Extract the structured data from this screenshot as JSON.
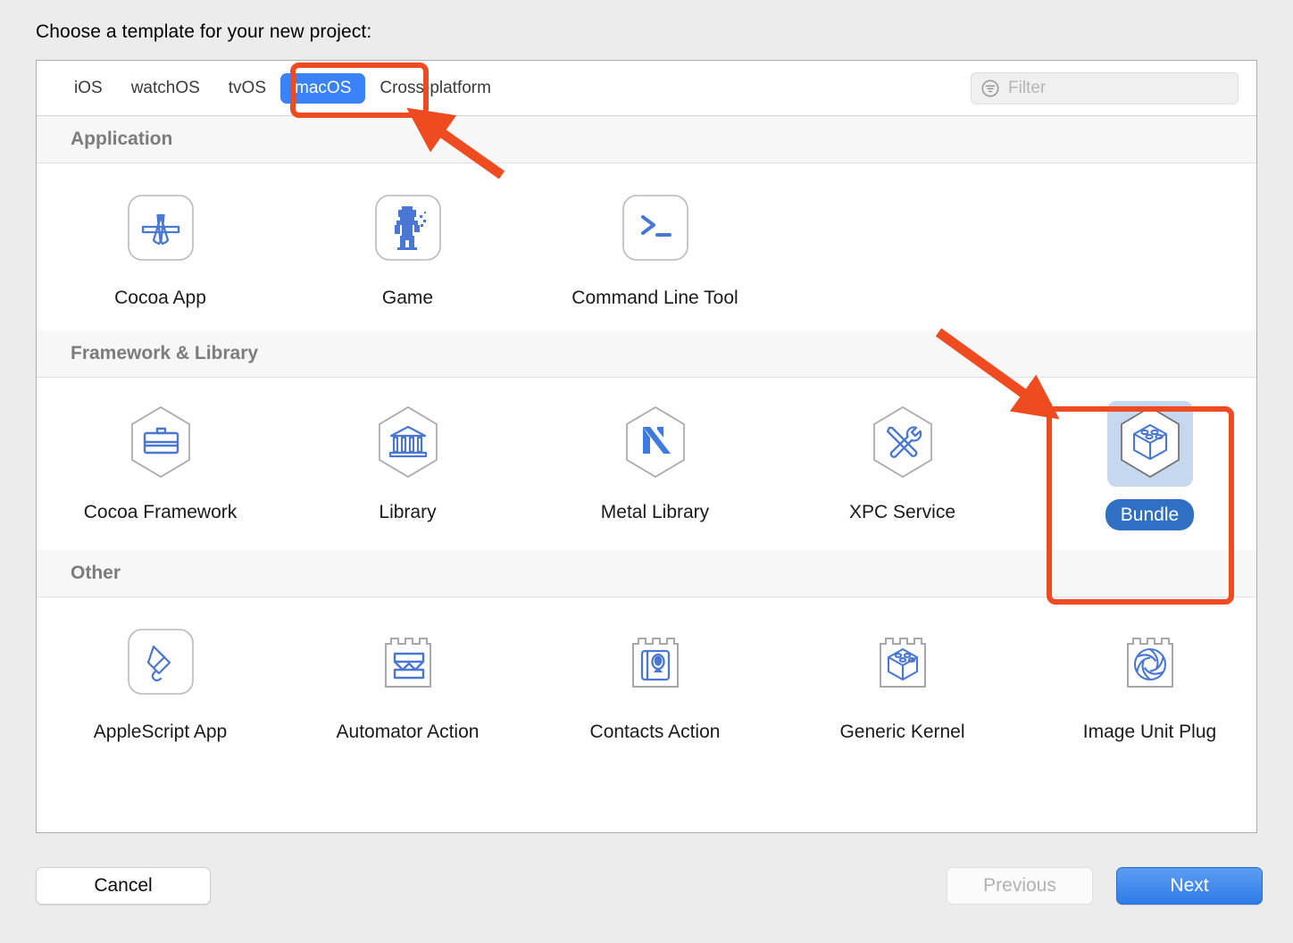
{
  "dialog": {
    "title": "Choose a template for your new project:"
  },
  "tabs": {
    "items": [
      {
        "label": "iOS",
        "selected": false
      },
      {
        "label": "watchOS",
        "selected": false
      },
      {
        "label": "tvOS",
        "selected": false
      },
      {
        "label": "macOS",
        "selected": true
      },
      {
        "label": "Cross-platform",
        "selected": false
      }
    ]
  },
  "filter": {
    "placeholder": "Filter",
    "value": "",
    "icon": "filter-icon"
  },
  "sections": [
    {
      "header": "Application",
      "items": [
        {
          "label": "Cocoa App",
          "icon": "cocoa-app-icon",
          "selected": false
        },
        {
          "label": "Game",
          "icon": "game-icon",
          "selected": false
        },
        {
          "label": "Command Line Tool",
          "icon": "command-line-tool-icon",
          "selected": false
        }
      ]
    },
    {
      "header": "Framework & Library",
      "items": [
        {
          "label": "Cocoa Framework",
          "icon": "cocoa-framework-icon",
          "selected": false
        },
        {
          "label": "Library",
          "icon": "library-icon",
          "selected": false
        },
        {
          "label": "Metal Library",
          "icon": "metal-library-icon",
          "selected": false
        },
        {
          "label": "XPC Service",
          "icon": "xpc-service-icon",
          "selected": false
        },
        {
          "label": "Bundle",
          "icon": "bundle-icon",
          "selected": true
        }
      ]
    },
    {
      "header": "Other",
      "items": [
        {
          "label": "AppleScript App",
          "icon": "applescript-app-icon",
          "selected": false
        },
        {
          "label": "Automator Action",
          "icon": "automator-action-icon",
          "selected": false
        },
        {
          "label": "Contacts Action",
          "icon": "contacts-action-icon",
          "selected": false
        },
        {
          "label": "Generic Kernel",
          "icon": "generic-kernel-icon",
          "selected": false
        },
        {
          "label": "Image Unit Plug",
          "icon": "image-unit-plugin-icon",
          "selected": false
        }
      ]
    }
  ],
  "footer": {
    "cancel": "Cancel",
    "previous": "Previous",
    "next": "Next"
  },
  "annotations": {
    "color": "#ee4b21",
    "highlight_macos_tab": "macOS",
    "highlight_bundle_item": "Bundle"
  },
  "colors": {
    "accent_blue": "#3a82f7",
    "selected_label_blue": "#2f6fc4",
    "selection_fill": "#c6d8f0",
    "annotation_orange": "#ee4b21",
    "section_header_bg": "#f7f7f7",
    "icon_blue": "#4a77d4"
  }
}
